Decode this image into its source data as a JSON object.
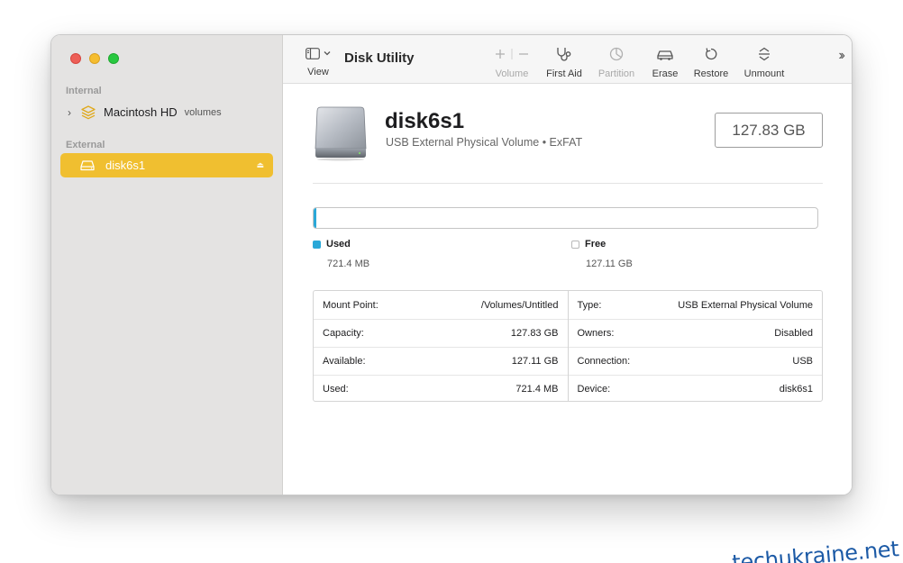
{
  "window": {
    "traffic_lights": {
      "close": "#ed5f57",
      "minimize": "#f5bd2f",
      "zoom": "#28c840"
    }
  },
  "sidebar": {
    "sections": [
      {
        "label": "Internal",
        "items": [
          {
            "label": "Macintosh HD",
            "sublabel": "volumes",
            "icon": "layers-icon",
            "expandable": true
          }
        ]
      },
      {
        "label": "External",
        "items": [
          {
            "label": "disk6s1",
            "icon": "external-drive-icon",
            "selected": true,
            "eject_icon": "eject-icon"
          }
        ]
      }
    ],
    "selected_color": "#f0bf30"
  },
  "toolbar": {
    "view_label": "View",
    "title": "Disk Utility",
    "buttons": [
      {
        "label": "Volume",
        "icon": "plus-minus-icon",
        "enabled": false
      },
      {
        "label": "First Aid",
        "icon": "stethoscope-icon",
        "enabled": true
      },
      {
        "label": "Partition",
        "icon": "pie-chart-icon",
        "enabled": false
      },
      {
        "label": "Erase",
        "icon": "car-disk-icon",
        "enabled": true
      },
      {
        "label": "Restore",
        "icon": "restore-arrow-icon",
        "enabled": true
      },
      {
        "label": "Unmount",
        "icon": "unmount-icon",
        "enabled": true
      }
    ],
    "overflow_icon": "chevron-double-right-icon"
  },
  "disk": {
    "name": "disk6s1",
    "description": "USB External Physical Volume • ExFAT",
    "capacity": "127.83 GB",
    "icon": "hard-drive-icon"
  },
  "usage": {
    "used_fraction": 0.0056,
    "accent": "#2aa8d8",
    "used": {
      "label": "Used",
      "value": "721.4 MB"
    },
    "free": {
      "label": "Free",
      "value": "127.11 GB"
    }
  },
  "info": {
    "left": [
      {
        "key": "Mount Point:",
        "value": "/Volumes/Untitled"
      },
      {
        "key": "Capacity:",
        "value": "127.83 GB"
      },
      {
        "key": "Available:",
        "value": "127.11 GB"
      },
      {
        "key": "Used:",
        "value": "721.4 MB"
      }
    ],
    "right": [
      {
        "key": "Type:",
        "value": "USB External Physical Volume"
      },
      {
        "key": "Owners:",
        "value": "Disabled"
      },
      {
        "key": "Connection:",
        "value": "USB"
      },
      {
        "key": "Device:",
        "value": "disk6s1"
      }
    ]
  },
  "watermark": "techukraine.net"
}
